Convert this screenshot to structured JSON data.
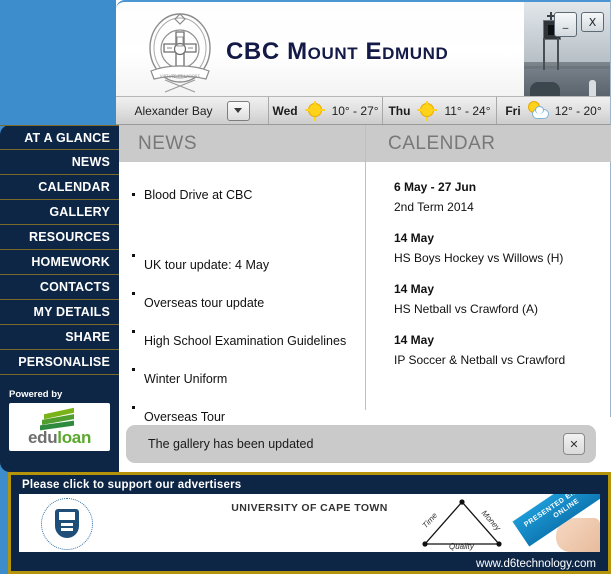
{
  "window": {
    "title": "CBC Mount Edmund",
    "minimize_label": "_",
    "close_label": "X",
    "crest_icon": "school-crest-icon",
    "photo_icon": "school-building-photo"
  },
  "weather": {
    "location": "Alexander Bay",
    "dropdown_icon": "chevron-down-icon",
    "days": [
      {
        "day": "Wed",
        "temps": "10° - 27°",
        "icon": "sun-icon"
      },
      {
        "day": "Thu",
        "temps": "11° - 24°",
        "icon": "sun-icon"
      },
      {
        "day": "Fri",
        "temps": "12° - 20°",
        "icon": "sun-cloud-icon"
      }
    ]
  },
  "sidebar": {
    "items": [
      {
        "label": "AT A GLANCE"
      },
      {
        "label": "NEWS"
      },
      {
        "label": "CALENDAR"
      },
      {
        "label": "GALLERY"
      },
      {
        "label": "RESOURCES"
      },
      {
        "label": "HOMEWORK"
      },
      {
        "label": "CONTACTS"
      },
      {
        "label": "MY DETAILS"
      },
      {
        "label": "SHARE"
      },
      {
        "label": "PERSONALISE"
      }
    ],
    "powered_by": "Powered by",
    "sponsor_name_a": "edu",
    "sponsor_name_b": "loan"
  },
  "news": {
    "heading": "NEWS",
    "items": [
      {
        "title": "Blood Drive at CBC"
      },
      {
        "title": "UK tour update: 4 May"
      },
      {
        "title": "Overseas tour update"
      },
      {
        "title": "High School Examination Guidelines"
      },
      {
        "title": "Winter Uniform"
      },
      {
        "title": "Overseas Tour"
      }
    ]
  },
  "calendar": {
    "heading": "CALENDAR",
    "events": [
      {
        "date": "6 May - 27 Jun",
        "description": "2nd Term 2014"
      },
      {
        "date": "14 May",
        "description": "HS Boys Hockey vs Willows (H)"
      },
      {
        "date": "14 May",
        "description": "HS Netball vs Crawford (A)"
      },
      {
        "date": "14 May",
        "description": "IP Soccer & Netball vs Crawford"
      }
    ]
  },
  "notification": {
    "message": "The gallery has been updated",
    "close_label": "✕"
  },
  "advert": {
    "heading": "Please click to support our advertisers",
    "advertiser": "UNIVERSITY OF CAPE TOWN",
    "logo_icon": "uct-crest-icon",
    "ribbon_text": "PRESENTED ENTIRELY ONLINE",
    "triangle_labels": [
      "Time",
      "Money",
      "Quality"
    ],
    "url": "www.d6technology.com"
  },
  "colors": {
    "desktop": "#3d8dcc",
    "navy": "#0d2645",
    "gold": "#b5930b",
    "panel_header": "#cacaca",
    "title_navy": "#141a47"
  }
}
